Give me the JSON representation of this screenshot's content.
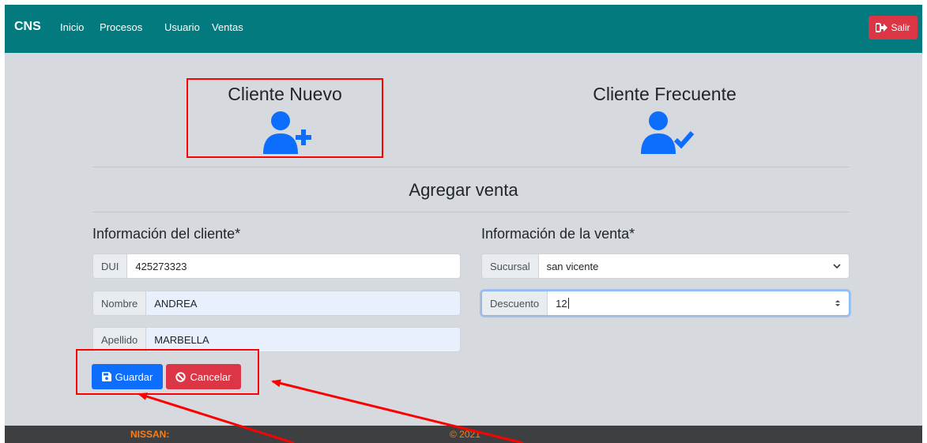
{
  "navbar": {
    "brand": "CNS",
    "links": [
      "Inicio",
      "Procesos",
      "Usuario",
      "Ventas"
    ],
    "logout_label": "Salir"
  },
  "choices": {
    "new_client": {
      "label": "Cliente Nuevo",
      "icon": "user-plus-icon"
    },
    "frequent_client": {
      "label": "Cliente Frecuente",
      "icon": "user-check-icon"
    }
  },
  "section_title": "Agregar venta",
  "client_info": {
    "heading": "Información del cliente*",
    "fields": [
      {
        "label": "DUI",
        "value": "425273323"
      },
      {
        "label": "Nombre",
        "value": "ANDREA"
      },
      {
        "label": "Apellido",
        "value": "MARBELLA"
      }
    ]
  },
  "sale_info": {
    "heading": "Información de la venta*",
    "branch": {
      "label": "Sucursal",
      "value": "san vicente"
    },
    "discount": {
      "label": "Descuento",
      "value": "12"
    }
  },
  "actions": {
    "save_label": "Guardar",
    "cancel_label": "Cancelar"
  },
  "footer": {
    "brand": "NISSAN:",
    "copyright": "© 2021"
  },
  "colors": {
    "navbar": "#037b7e",
    "primary": "#0d6efd",
    "danger": "#dc3545",
    "annotation": "#ff0000"
  }
}
